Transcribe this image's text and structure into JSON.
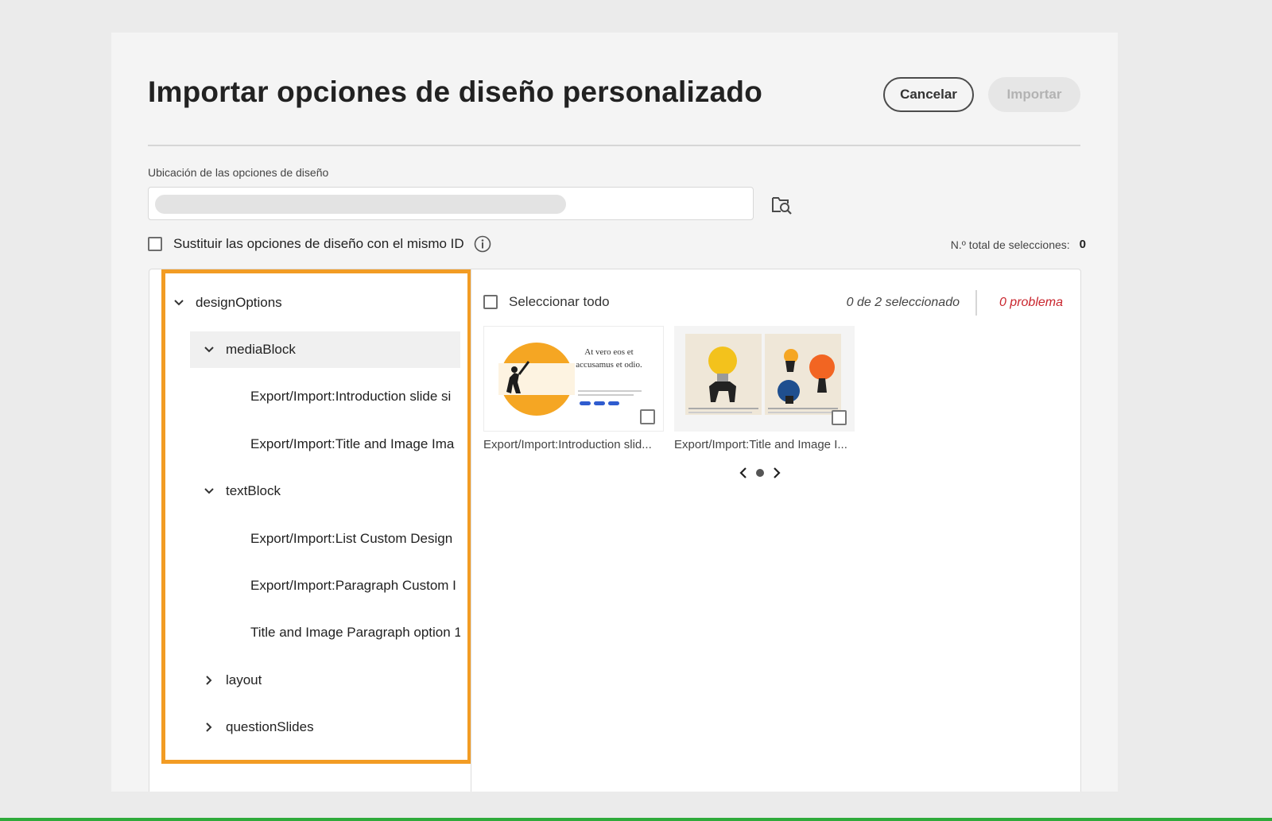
{
  "dialog": {
    "title": "Importar opciones de diseño personalizado",
    "cancel_label": "Cancelar",
    "import_label": "Importar"
  },
  "location": {
    "label": "Ubicación de las opciones de diseño",
    "value": ""
  },
  "replace": {
    "label": "Sustituir las opciones de diseño con el mismo ID",
    "checked": false
  },
  "total": {
    "label": "N.º total de selecciones:",
    "count": "0"
  },
  "tree": {
    "root": "designOptions",
    "items": [
      {
        "label": "mediaBlock",
        "type": "group",
        "expanded": true
      },
      {
        "label": "Export/Import:Introduction slide si",
        "type": "leaf"
      },
      {
        "label": "Export/Import:Title and Image Ima",
        "type": "leaf"
      },
      {
        "label": "textBlock",
        "type": "group",
        "expanded": true
      },
      {
        "label": "Export/Import:List Custom Design",
        "type": "leaf"
      },
      {
        "label": "Export/Import:Paragraph Custom I",
        "type": "leaf"
      },
      {
        "label": "Title and Image Paragraph option 1",
        "type": "leaf"
      },
      {
        "label": "layout",
        "type": "group",
        "expanded": false
      },
      {
        "label": "questionSlides",
        "type": "group",
        "expanded": false
      }
    ]
  },
  "content": {
    "select_all_label": "Seleccionar todo",
    "selected_count": "0 de 2 seleccionado",
    "problems": "0 problema",
    "cards": [
      {
        "label": "Export/Import:Introduction slid...",
        "thumb_text": "At vero eos et accusamus et odio."
      },
      {
        "label": "Export/Import:Title and Image I..."
      }
    ],
    "pager": {
      "current": 1,
      "total": 1
    }
  },
  "colors": {
    "highlight": "#f29c24",
    "problem": "#c9252d",
    "accent_orange": "#f5a623",
    "accent_blue": "#2f5ccf"
  }
}
